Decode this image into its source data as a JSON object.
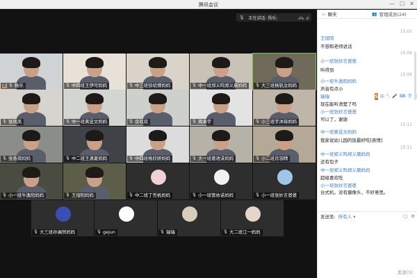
{
  "window": {
    "title": "腾讯会议",
    "minimize": "—",
    "maximize": "☐",
    "close": "✕"
  },
  "speaking": {
    "label": "正在讲话: 杨乐;"
  },
  "tiles": [
    {
      "name": "杨乐",
      "host": true
    },
    {
      "name": "中四班王伊可妈妈"
    },
    {
      "name": "中三班徐绍博妈妈"
    },
    {
      "name": "中一班郑义鸣郑义晨妈妈"
    },
    {
      "name": "大三班杨钒汝妈妈",
      "active": true
    },
    {
      "name": "张凤凤"
    },
    {
      "name": "中一班黄昱文妈妈"
    },
    {
      "name": "余欢欢"
    },
    {
      "name": "周承宇"
    },
    {
      "name": "小三班宇沐琛妈妈"
    },
    {
      "name": "张香祺妈妈"
    },
    {
      "name": "中二班王潇夏妈妈"
    },
    {
      "name": "中四班杨欣妍妈妈"
    },
    {
      "name": "大一班葛语沫妈妈"
    },
    {
      "name": "小二班肖羽晴"
    },
    {
      "name": "小一班牛逸阳妈妈"
    },
    {
      "name": "王熠阳妈妈"
    },
    {
      "name": "中二班丁哲帆妈妈"
    },
    {
      "name": "小一班管依诺妈妈"
    },
    {
      "name": "小一班张妙言爸爸"
    },
    {
      "name": "大三班孙澜然妈妈"
    },
    {
      "name": "gejun"
    },
    {
      "name": "瑞瑞"
    },
    {
      "name": "大二班江一妈妈"
    }
  ],
  "sidebar": {
    "tab_chat": "聊天",
    "tab_members": "管理成员(24)"
  },
  "chat": {
    "messages": [
      {
        "kind": "name",
        "text": "王熠阳"
      },
      {
        "kind": "text",
        "text": "不想和老师说话"
      },
      {
        "kind": "name",
        "text": "小一班张妙言爸爸"
      },
      {
        "kind": "text",
        "text": "听得到"
      },
      {
        "kind": "name",
        "text": "小一班牛逸阳妈妈"
      },
      {
        "kind": "text",
        "text": "声音有点小"
      },
      {
        "kind": "name",
        "text": "瑞瑞"
      },
      {
        "kind": "text",
        "text": "现在能听清楚了吗"
      },
      {
        "kind": "name",
        "text": "小一班张妙言爸爸"
      },
      {
        "kind": "text",
        "text": "可以了，谢谢"
      },
      {
        "kind": "name",
        "text": "中一班黄昱文妈妈"
      },
      {
        "kind": "text",
        "text": "我家说幼儿园的饭最好吃[表情]"
      },
      {
        "kind": "name",
        "text": "中一班郑义鸣郑义晨妈妈"
      },
      {
        "kind": "text",
        "text": "还有包子"
      },
      {
        "kind": "name",
        "text": "中一班郑义鸣郑义晨妈妈"
      },
      {
        "kind": "text",
        "text": "超级喜欢吃"
      },
      {
        "kind": "name",
        "text": "小一班张妙言爸爸"
      },
      {
        "kind": "text",
        "text": "台式机，没有摄像头，不好意思。"
      }
    ],
    "timestamps": [
      "15:02",
      "15:04",
      "15:09",
      "15:11",
      "15:11"
    ]
  },
  "composer": {
    "to_label": "发送至:",
    "to_value": "所有人 ▾",
    "send_label": "发送(S)"
  },
  "ime": {
    "brand": "S",
    "items": [
      "中",
      "°,",
      "🎤",
      "⌨",
      "👕",
      "⋮"
    ]
  }
}
